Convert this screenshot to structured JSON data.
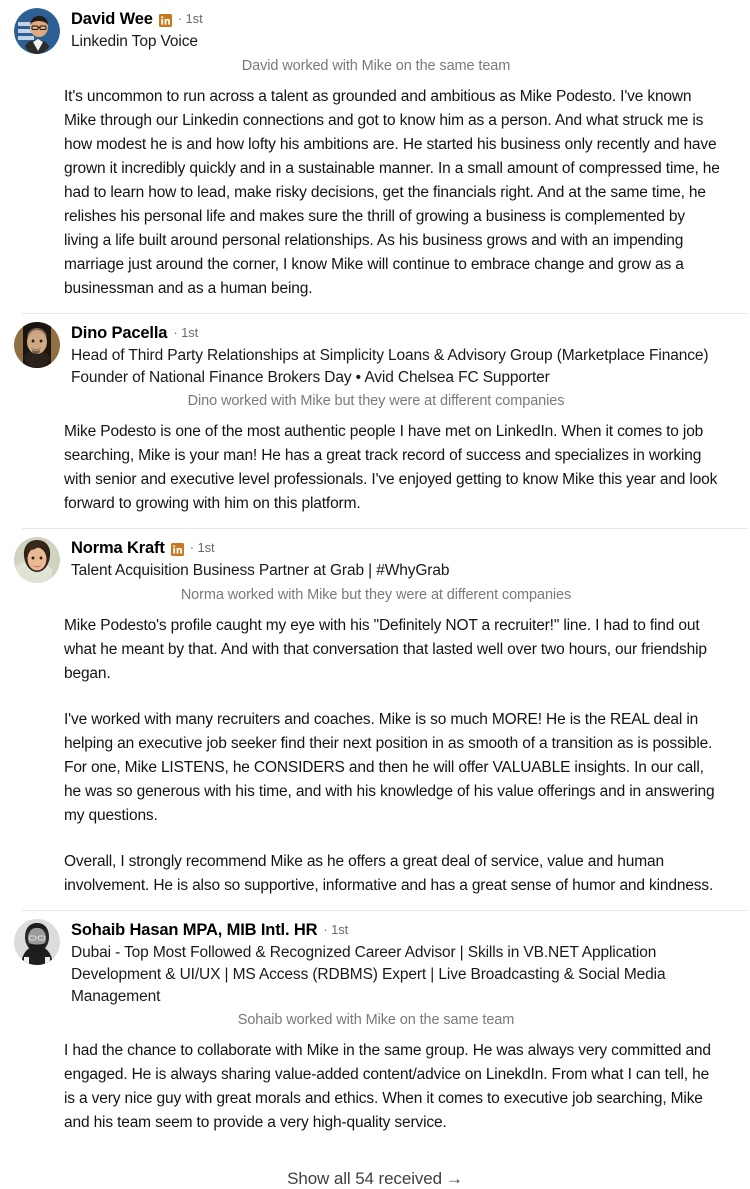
{
  "section": {
    "type": "linkedin-recommendations-received",
    "badge_color": "#c8791f",
    "divider_color": "#e8e8e8",
    "footer": {
      "label": "Show all 54 received",
      "count": 54,
      "arrow": "→",
      "icon": "arrow-right-icon"
    }
  },
  "recommendations": [
    {
      "avatar": "avatar-david-wee",
      "name": "David Wee",
      "has_linkedin_badge": true,
      "badge_icon": "linkedin-icon",
      "degree": "· 1st",
      "headline": "Linkedin Top Voice",
      "relation": "David worked with Mike on the same team",
      "paragraphs": [
        "It's uncommon to run across a talent as grounded and ambitious as Mike Podesto. I've known Mike through our Linkedin connections and got to know him as a person. And what struck me is how modest he is and how lofty his ambitions are. He started his business only recently and have grown it incredibly quickly and in a sustainable manner. In a small amount of compressed time, he had to learn how to lead, make risky decisions, get the financials right. And at the same time, he relishes his personal life and makes sure the thrill of growing a business is complemented by living a life built around personal relationships. As his business grows and with an impending marriage just around the corner, I know Mike will continue to embrace change and grow as a businessman and as a human being."
      ]
    },
    {
      "avatar": "avatar-dino-pacella",
      "name": "Dino Pacella",
      "has_linkedin_badge": false,
      "badge_icon": null,
      "degree": "· 1st",
      "headline": "Head of Third Party Relationships at Simplicity Loans & Advisory Group (Marketplace Finance) Founder of National Finance Brokers Day • Avid Chelsea FC Supporter",
      "relation": "Dino worked with Mike but they were at different companies",
      "paragraphs": [
        "Mike Podesto is one of the most authentic people I have met on LinkedIn. When it comes to job searching, Mike is your man! He has a great track record of success and specializes in working with senior and executive level professionals. I've enjoyed getting to know Mike this year and look forward to growing with him on this platform."
      ]
    },
    {
      "avatar": "avatar-norma-kraft",
      "name": "Norma Kraft",
      "has_linkedin_badge": true,
      "badge_icon": "linkedin-icon",
      "degree": "· 1st",
      "headline": "Talent Acquisition Business Partner at Grab | #WhyGrab",
      "relation": "Norma worked with Mike but they were at different companies",
      "paragraphs": [
        "Mike Podesto's profile caught my eye with his \"Definitely NOT a recruiter!\" line. I had to find out what he meant by that. And with that conversation that lasted well over two hours, our friendship began.",
        "I've worked with many recruiters and coaches. Mike is so much MORE! He is the REAL deal in helping an executive job seeker find their next position in as smooth of a transition as is possible. For one, Mike LISTENS, he CONSIDERS and then he will offer VALUABLE insights. In our call, he was so generous with his time, and with his knowledge of his value offerings and in answering my questions.",
        "Overall, I strongly recommend Mike as he offers a great deal of service, value and human involvement. He is also so supportive, informative and has a great sense of humor and kindness."
      ]
    },
    {
      "avatar": "avatar-sohaib-hasan",
      "name": "Sohaib Hasan MPA, MIB Intl. HR",
      "has_linkedin_badge": false,
      "badge_icon": null,
      "degree": "· 1st",
      "headline": "Dubai - Top Most Followed & Recognized Career Advisor | Skills in VB.NET Application Development & UI/UX | MS Access (RDBMS) Expert | Live Broadcasting & Social Media Management",
      "relation": "Sohaib worked with Mike on the same team",
      "paragraphs": [
        "I had the chance to collaborate with Mike in the same group. He was always very committed and engaged. He is always sharing value-added content/advice on LinekdIn. From what I can tell, he is a very nice guy with great morals and ethics. When it comes to executive job searching, Mike and his team seem to provide a very high-quality service."
      ]
    }
  ]
}
